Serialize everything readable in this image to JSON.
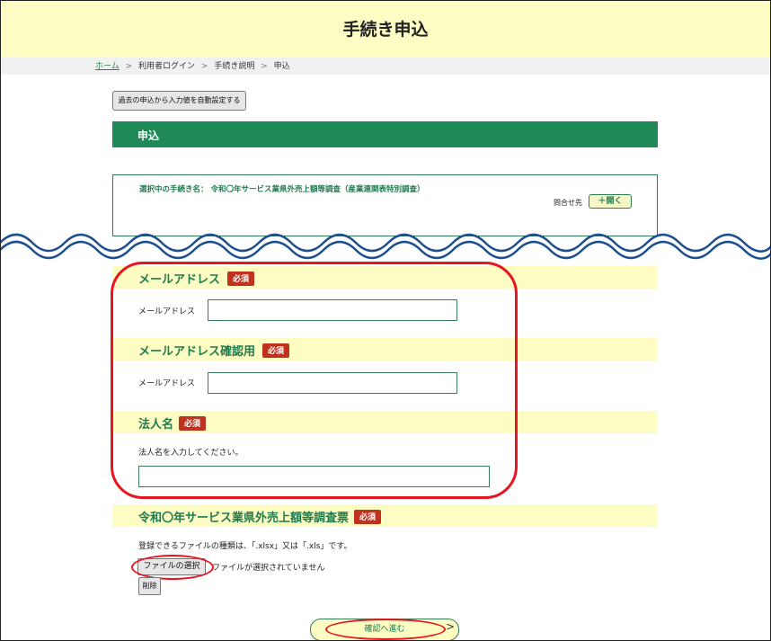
{
  "header": {
    "title": "手続き申込"
  },
  "breadcrumb": {
    "home": "ホーム",
    "items": [
      "利用者ログイン",
      "手続き説明",
      "申込"
    ],
    "separator": ">"
  },
  "buttons": {
    "auto_fill": "過去の申込から入力値を自動設定する",
    "open": "＋開く",
    "choose_file": "ファイルの選択",
    "delete": "削除",
    "confirm": "確認へ進む",
    "confirm_arrow": ">"
  },
  "section": {
    "title": "申込"
  },
  "procedure": {
    "selected_label": "選択中の手続き名： 令和〇年サービス業県外売上額等調査（産業連関表特別調査）",
    "inquiry_label": "問合せ先"
  },
  "fields": {
    "email": {
      "title": "メールアドレス",
      "required": "必須",
      "label": "メールアドレス",
      "value": ""
    },
    "email_confirm": {
      "title": "メールアドレス確認用",
      "required": "必須",
      "label": "メールアドレス",
      "value": ""
    },
    "company": {
      "title": "法人名",
      "required": "必須",
      "instruction": "法人名を入力してください。",
      "value": ""
    },
    "survey_file": {
      "title": "令和〇年サービス業県外売上額等調査票",
      "required": "必須",
      "note": "登録できるファイルの種類は、「.xlsx」又は「.xls」です。",
      "status": "ファイルが選択されていません"
    }
  },
  "colors": {
    "header_bg": "#fdfcc3",
    "primary_green": "#1f8a57",
    "required_red": "#c0311e",
    "highlight_red": "#e8141f",
    "wave_blue": "#1f4f8f"
  }
}
